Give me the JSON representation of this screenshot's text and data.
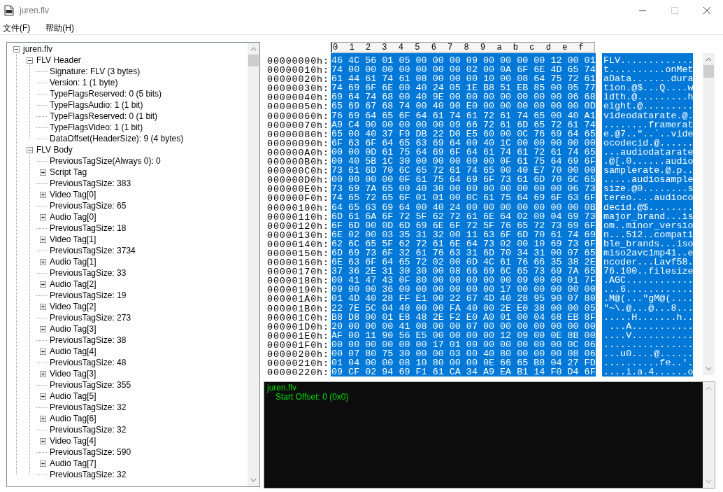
{
  "window": {
    "title": "juren.flv"
  },
  "menu": [
    "文件(F)",
    "帮助(H)"
  ],
  "tree": [
    {
      "label": "juren.flv",
      "expanded": true,
      "children": [
        {
          "label": "FLV Header",
          "expanded": true,
          "children": [
            {
              "label": "Signature: FLV  (3 bytes)"
            },
            {
              "label": "Version: 1  (1 byte)"
            },
            {
              "label": "TypeFlagsReserved: 0  (5 bits)"
            },
            {
              "label": "TypeFlagsAudio: 1  (1 bit)"
            },
            {
              "label": "TypeFlagsReserved: 0  (1 bit)"
            },
            {
              "label": "TypeFlagsVideo: 1  (1 bit)"
            },
            {
              "label": "DataOffset(HeaderSize): 9  (4 bytes)"
            }
          ]
        },
        {
          "label": "FLV Body",
          "expanded": true,
          "children": [
            {
              "label": "PreviousTagSize(Always 0): 0"
            },
            {
              "label": "Script Tag",
              "expanded": false
            },
            {
              "label": "PreviousTagSize: 383"
            },
            {
              "label": "Video Tag[0]",
              "expanded": false
            },
            {
              "label": "PreviousTagSize: 65"
            },
            {
              "label": "Audio Tag[0]",
              "expanded": false
            },
            {
              "label": "PreviousTagSize: 18"
            },
            {
              "label": "Video Tag[1]",
              "expanded": false
            },
            {
              "label": "PreviousTagSize: 3734"
            },
            {
              "label": "Audio Tag[1]",
              "expanded": false
            },
            {
              "label": "PreviousTagSize: 33"
            },
            {
              "label": "Audio Tag[2]",
              "expanded": false
            },
            {
              "label": "PreviousTagSize: 19"
            },
            {
              "label": "Video Tag[2]",
              "expanded": false
            },
            {
              "label": "PreviousTagSize: 273"
            },
            {
              "label": "Audio Tag[3]",
              "expanded": false
            },
            {
              "label": "PreviousTagSize: 38"
            },
            {
              "label": "Audio Tag[4]",
              "expanded": false
            },
            {
              "label": "PreviousTagSize: 48"
            },
            {
              "label": "Video Tag[3]",
              "expanded": false
            },
            {
              "label": "PreviousTagSize: 355"
            },
            {
              "label": "Audio Tag[5]",
              "expanded": false
            },
            {
              "label": "PreviousTagSize: 32"
            },
            {
              "label": "Audio Tag[6]",
              "expanded": false
            },
            {
              "label": "PreviousTagSize: 32"
            },
            {
              "label": "Video Tag[4]",
              "expanded": false
            },
            {
              "label": "PreviousTagSize: 590"
            },
            {
              "label": "Audio Tag[7]",
              "expanded": false
            },
            {
              "label": "PreviousTagSize: 32"
            }
          ]
        }
      ]
    }
  ],
  "hex_view": {
    "highlighted": true,
    "columns": [
      "0",
      "1",
      "2",
      "3",
      "4",
      "5",
      "6",
      "7",
      "8",
      "9",
      "a",
      "b",
      "c",
      "d",
      "e",
      "f"
    ],
    "rows": [
      {
        "offset": "00000000h:",
        "hex": "46 4C 56 01 05 00 00 00 09 00 00 00 00 12 00 01",
        "ascii": "FLV............."
      },
      {
        "offset": "00000010h:",
        "hex": "74 00 00 00 00 00 00 00 02 00 0A 6F 6E 4D 65 74",
        "ascii": "t..........onMet"
      },
      {
        "offset": "00000020h:",
        "hex": "61 44 61 74 61 08 00 00 00 10 00 08 64 75 72 61",
        "ascii": "aData.......dura"
      },
      {
        "offset": "00000030h:",
        "hex": "74 69 6F 6E 00 40 24 05 1E B8 51 EB 85 00 05 77",
        "ascii": "tion.@$...Q....w"
      },
      {
        "offset": "00000040h:",
        "hex": "69 64 74 68 00 40 9E 00 00 00 00 00 00 00 06 68",
        "ascii": "idth.@.........h"
      },
      {
        "offset": "00000050h:",
        "hex": "65 69 67 68 74 00 40 90 E0 00 00 00 00 00 00 0D",
        "ascii": "eight.@........."
      },
      {
        "offset": "00000060h:",
        "hex": "76 69 64 65 6F 64 61 74 61 72 61 74 65 00 40 A1",
        "ascii": "videodatarate.@."
      },
      {
        "offset": "00000070h:",
        "hex": "A9 C4 00 00 00 00 00 09 66 72 61 6D 65 72 61 74",
        "ascii": "........framerat"
      },
      {
        "offset": "00000080h:",
        "hex": "65 00 40 37 F9 DB 22 D0 E5 60 00 0C 76 69 64 65",
        "ascii": "e.@7..\"..`..vide"
      },
      {
        "offset": "00000090h:",
        "hex": "6F 63 6F 64 65 63 69 64 00 40 1C 00 00 00 00 00",
        "ascii": "ocodecid.@......"
      },
      {
        "offset": "000000A0h:",
        "hex": "00 00 0D 61 75 64 69 6F 64 61 74 61 72 61 74 65",
        "ascii": "...audiodatarate"
      },
      {
        "offset": "000000B0h:",
        "hex": "00 40 5B 1C 30 00 00 00 00 00 0F 61 75 64 69 6F",
        "ascii": ".@[.0......audio"
      },
      {
        "offset": "000000C0h:",
        "hex": "73 61 6D 70 6C 65 72 61 74 65 00 40 E7 70 00 00",
        "ascii": "samplerate.@.p.."
      },
      {
        "offset": "000000D0h:",
        "hex": "00 00 00 00 0F 61 75 64 69 6F 73 61 6D 70 6C 65",
        "ascii": ".....audiosample"
      },
      {
        "offset": "000000E0h:",
        "hex": "73 69 7A 65 00 40 30 00 00 00 00 00 00 00 06 73",
        "ascii": "size.@0........s"
      },
      {
        "offset": "000000F0h:",
        "hex": "74 65 72 65 6F 01 01 00 0C 61 75 64 69 6F 63 6F",
        "ascii": "tereo....audioco"
      },
      {
        "offset": "00000100h:",
        "hex": "64 65 63 69 64 00 40 24 00 00 00 00 00 00 00 0B",
        "ascii": "decid.@$........"
      },
      {
        "offset": "00000110h:",
        "hex": "6D 61 6A 6F 72 5F 62 72 61 6E 64 02 00 04 69 73",
        "ascii": "major_brand...is"
      },
      {
        "offset": "00000120h:",
        "hex": "6F 6D 00 0D 6D 69 6E 6F 72 5F 76 65 72 73 69 6F",
        "ascii": "om..minor_versio"
      },
      {
        "offset": "00000130h:",
        "hex": "6E 02 00 03 35 31 32 00 11 63 6F 6D 70 61 74 69",
        "ascii": "n...512..compati"
      },
      {
        "offset": "00000140h:",
        "hex": "62 6C 65 5F 62 72 61 6E 64 73 02 00 10 69 73 6F",
        "ascii": "ble_brands...iso"
      },
      {
        "offset": "00000150h:",
        "hex": "6D 69 73 6F 32 61 76 63 31 6D 70 34 31 00 07 65",
        "ascii": "miso2avc1mp41..e"
      },
      {
        "offset": "00000160h:",
        "hex": "6E 63 6F 64 65 72 02 00 0D 4C 61 76 66 35 38 2E",
        "ascii": "ncoder...Lavf58."
      },
      {
        "offset": "00000170h:",
        "hex": "37 36 2E 31 30 30 00 08 66 69 6C 65 73 69 7A 65",
        "ascii": "76.100..filesize"
      },
      {
        "offset": "00000180h:",
        "hex": "00 41 47 43 0F 80 00 00 00 00 00 09 00 00 01 7F",
        "ascii": ".AGC............"
      },
      {
        "offset": "00000190h:",
        "hex": "09 00 00 36 00 00 00 00 00 00 17 00 00 00 00 00",
        "ascii": "...6............"
      },
      {
        "offset": "000001A0h:",
        "hex": "01 4D 40 28 FF E1 00 22 67 4D 40 28 95 90 07 80",
        "ascii": ".M@(...\"gM@(...."
      },
      {
        "offset": "000001B0h:",
        "hex": "22 7E 5C 04 40 00 00 FA 40 00 2E E0 38 00 00 05",
        "ascii": "\"~\\.@...@...8..."
      },
      {
        "offset": "000001C0h:",
        "hex": "B8 D8 00 01 E8 48 2E F2 E0 A0 01 00 04 68 EB 8F",
        "ascii": ".....H.......h.."
      },
      {
        "offset": "000001D0h:",
        "hex": "20 00 00 00 41 08 00 00 07 00 00 00 00 00 00 00",
        "ascii": " ...A..........."
      },
      {
        "offset": "000001E0h:",
        "hex": "AF 00 11 90 56 E5 00 00 00 00 12 09 00 0E 8B 00",
        "ascii": "....V..........."
      },
      {
        "offset": "000001F0h:",
        "hex": "00 00 00 00 00 00 17 01 00 00 00 00 00 00 0C 06",
        "ascii": "................"
      },
      {
        "offset": "00000200h:",
        "hex": "00 07 80 75 30 00 00 03 00 40 80 00 00 00 08 06",
        "ascii": "...u0....@......"
      },
      {
        "offset": "00000210h:",
        "hex": "01 04 00 00 08 10 80 00 00 0E 66 65 B8 04 27 FD",
        "ascii": "..........fe..'."
      },
      {
        "offset": "00000220h:",
        "hex": "09 CF 02 94 69 F1 61 CA 34 A9 EA B1 14 F0 D4 6F",
        "ascii": "....i.a.4......o"
      }
    ]
  },
  "output": [
    {
      "kind": "heading",
      "text": "juren.flv"
    },
    {
      "kind": "detail",
      "text": "Start Offset: 0 (0x0)"
    }
  ]
}
